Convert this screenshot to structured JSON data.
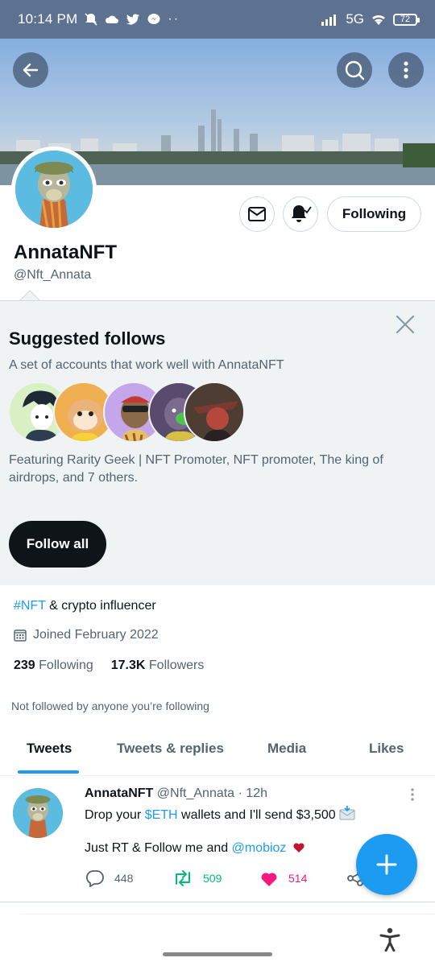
{
  "status_bar": {
    "time": "10:14 PM",
    "network": "5G",
    "battery": "72"
  },
  "profile": {
    "name": "AnnataNFT",
    "handle": "@Nft_Annata",
    "following_button": "Following",
    "bio_hashtag": "#NFT",
    "bio_rest": " & crypto influencer",
    "joined": "Joined February 2022",
    "following_count": "239",
    "following_label": "Following",
    "followers_count": "17.3K",
    "followers_label": "Followers",
    "not_followed": "Not followed by anyone you’re following"
  },
  "suggested": {
    "title": "Suggested follows",
    "subtitle": "A set of accounts that work well with AnnataNFT",
    "featuring": "Featuring Rarity Geek | NFT Promoter, NFT promoter, The king of airdrops, and 7 others.",
    "follow_all": "Follow all"
  },
  "tabs": [
    "Tweets",
    "Tweets & replies",
    "Media",
    "Likes"
  ],
  "tweet": {
    "author": "AnnataNFT",
    "handle_time": "@Nft_Annata · 12h",
    "text_before": "Drop your ",
    "cashtag": "$ETH",
    "text_after": " wallets and I'll send $3,500",
    "line2_before": "Just RT & Follow me and ",
    "mention": "@mobioz",
    "replies": "448",
    "retweets": "509",
    "likes": "514"
  },
  "colors": {
    "accent": "#1d9bf0",
    "retweet": "#00ba7c",
    "like": "#f91880",
    "dark": "#0f1419"
  },
  "icons": [
    "back-arrow-icon",
    "search-icon",
    "more-vertical-icon",
    "mail-icon",
    "bell-icon",
    "close-icon",
    "calendar-icon",
    "reply-icon",
    "retweet-icon",
    "heart-icon",
    "share-icon",
    "plus-icon",
    "accessibility-icon"
  ]
}
